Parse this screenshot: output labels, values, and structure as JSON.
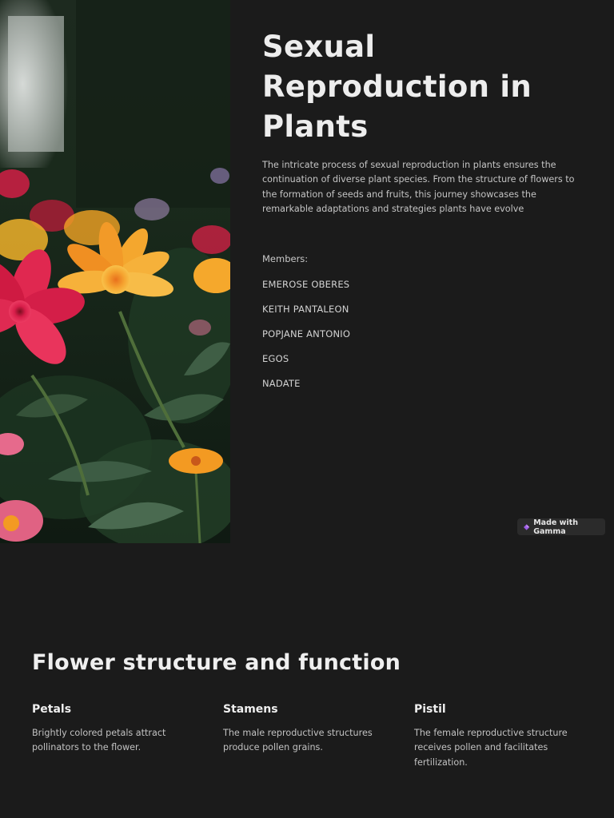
{
  "hero": {
    "title": "Sexual Reproduction in Plants",
    "intro": "The intricate process of sexual reproduction in plants ensures the continuation of diverse plant species. From the structure of flowers to the formation of seeds and fruits, this journey showcases the remarkable adaptations and strategies plants have evolve",
    "members_label": "Members:",
    "members": [
      "EMEROSE OBERES",
      "KEITH PANTALEON",
      "POPJANE ANTONIO",
      "EGOS",
      "NADATE"
    ]
  },
  "badge": {
    "label": "Made with Gamma",
    "icon": "gamma-gem-icon",
    "accent": "#9b5de5"
  },
  "section2": {
    "title": "Flower structure and function",
    "cards": [
      {
        "heading": "Petals",
        "text": "Brightly colored petals attract pollinators to the flower."
      },
      {
        "heading": "Stamens",
        "text": "The male reproductive structures produce pollen grains."
      },
      {
        "heading": "Pistil",
        "text": "The female reproductive structure receives pollen and facilitates fertilization."
      }
    ]
  },
  "colors": {
    "background": "#1b1b1b",
    "text": "#ededed",
    "muted": "#c4c4c4"
  }
}
